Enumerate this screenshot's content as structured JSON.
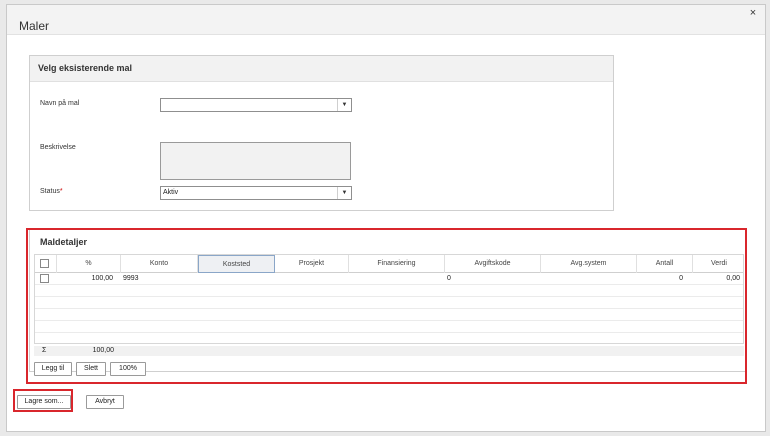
{
  "dialog": {
    "title": "Maler",
    "close_glyph": "×"
  },
  "template_panel": {
    "title": "Velg eksisterende mal",
    "name_label": "Navn på mal",
    "name_value": "",
    "description_label": "Beskrivelse",
    "status_label": "Status",
    "status_required_mark": "*",
    "status_value": "Aktiv",
    "dropdown_glyph": "▼"
  },
  "details": {
    "title": "Maldetaljer",
    "columns": [
      "%",
      "Konto",
      "Koststed",
      "Prosjekt",
      "Finansiering",
      "Avgiftskode",
      "Avg.system",
      "Antall",
      "Verdi"
    ],
    "rows": [
      {
        "percent": "100,00",
        "konto": "9993",
        "koststed": "",
        "prosjekt": "",
        "finansiering": "",
        "avgiftskode": "0",
        "avgsystem": "",
        "antall": "0",
        "verdi": "0,00"
      }
    ],
    "sum_symbol": "Σ",
    "sum_value": "100,00",
    "buttons": {
      "add": "Legg til",
      "delete": "Slett",
      "hundred": "100%"
    }
  },
  "footer": {
    "save_as": "Lagre som...",
    "cancel": "Avbryt"
  },
  "colors": {
    "highlight": "#d9262c",
    "selected_header_border": "#8aa6c8"
  }
}
